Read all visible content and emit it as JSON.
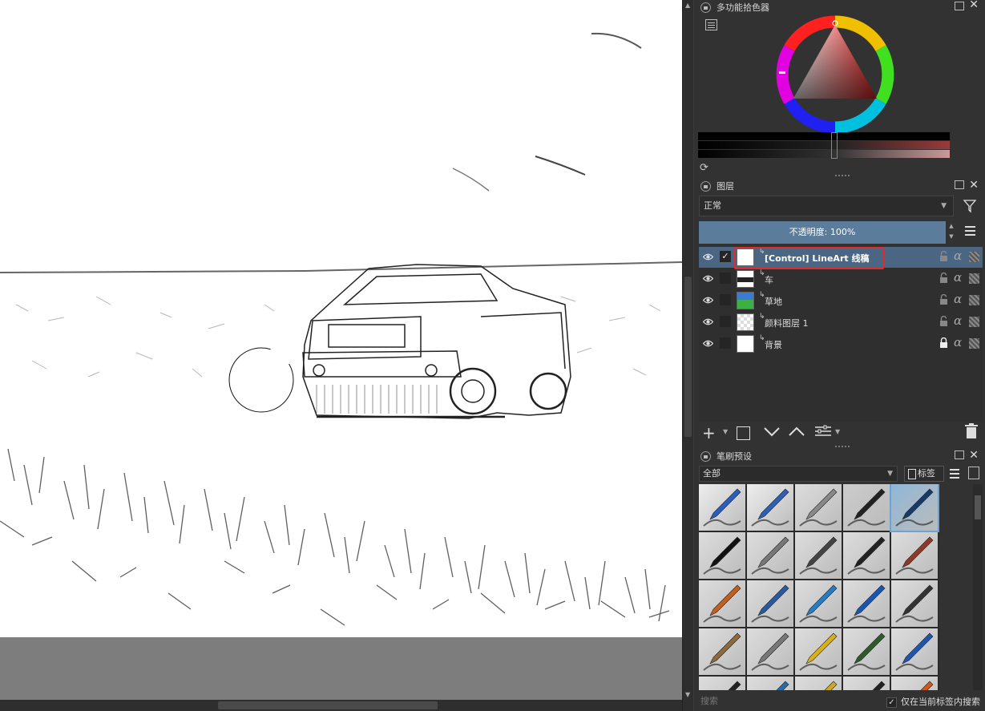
{
  "canvas": {
    "description_icon": "brush-cursor-circle"
  },
  "color_selector": {
    "title": "多功能拾色器",
    "icons": [
      "lock-icon",
      "float-icon",
      "close-icon",
      "settings-icon",
      "reset-icon"
    ]
  },
  "layers": {
    "title": "图层",
    "blend_mode": "正常",
    "opacity_label": "不透明度:  100%",
    "items": [
      {
        "name": "[Control] LineArt 线稿",
        "selected": true,
        "checked": true,
        "locked": false
      },
      {
        "name": "车",
        "selected": false,
        "checked": false,
        "locked": false
      },
      {
        "name": "草地",
        "selected": false,
        "checked": false,
        "locked": false
      },
      {
        "name": "颜料图层 1",
        "selected": false,
        "checked": false,
        "locked": false
      },
      {
        "name": "背景",
        "selected": false,
        "checked": false,
        "locked": true
      }
    ],
    "toolbar_icons": [
      "add-layer-icon",
      "duplicate-layer-icon",
      "move-down-icon",
      "move-up-icon",
      "layer-properties-icon",
      "delete-layer-icon"
    ]
  },
  "brushes": {
    "title": "笔刷预设",
    "tag_filter": "全部",
    "tag_button": "标签",
    "search_placeholder": "搜索",
    "search_in_tag_label": "仅在当前标签内搜索",
    "search_in_tag_checked": true
  },
  "colors": {
    "accent_selected_layer": "#4a6683",
    "opacity_bar": "#5b7c9b",
    "highlight_box": "#e12b2b",
    "panel_bg": "#323232"
  }
}
